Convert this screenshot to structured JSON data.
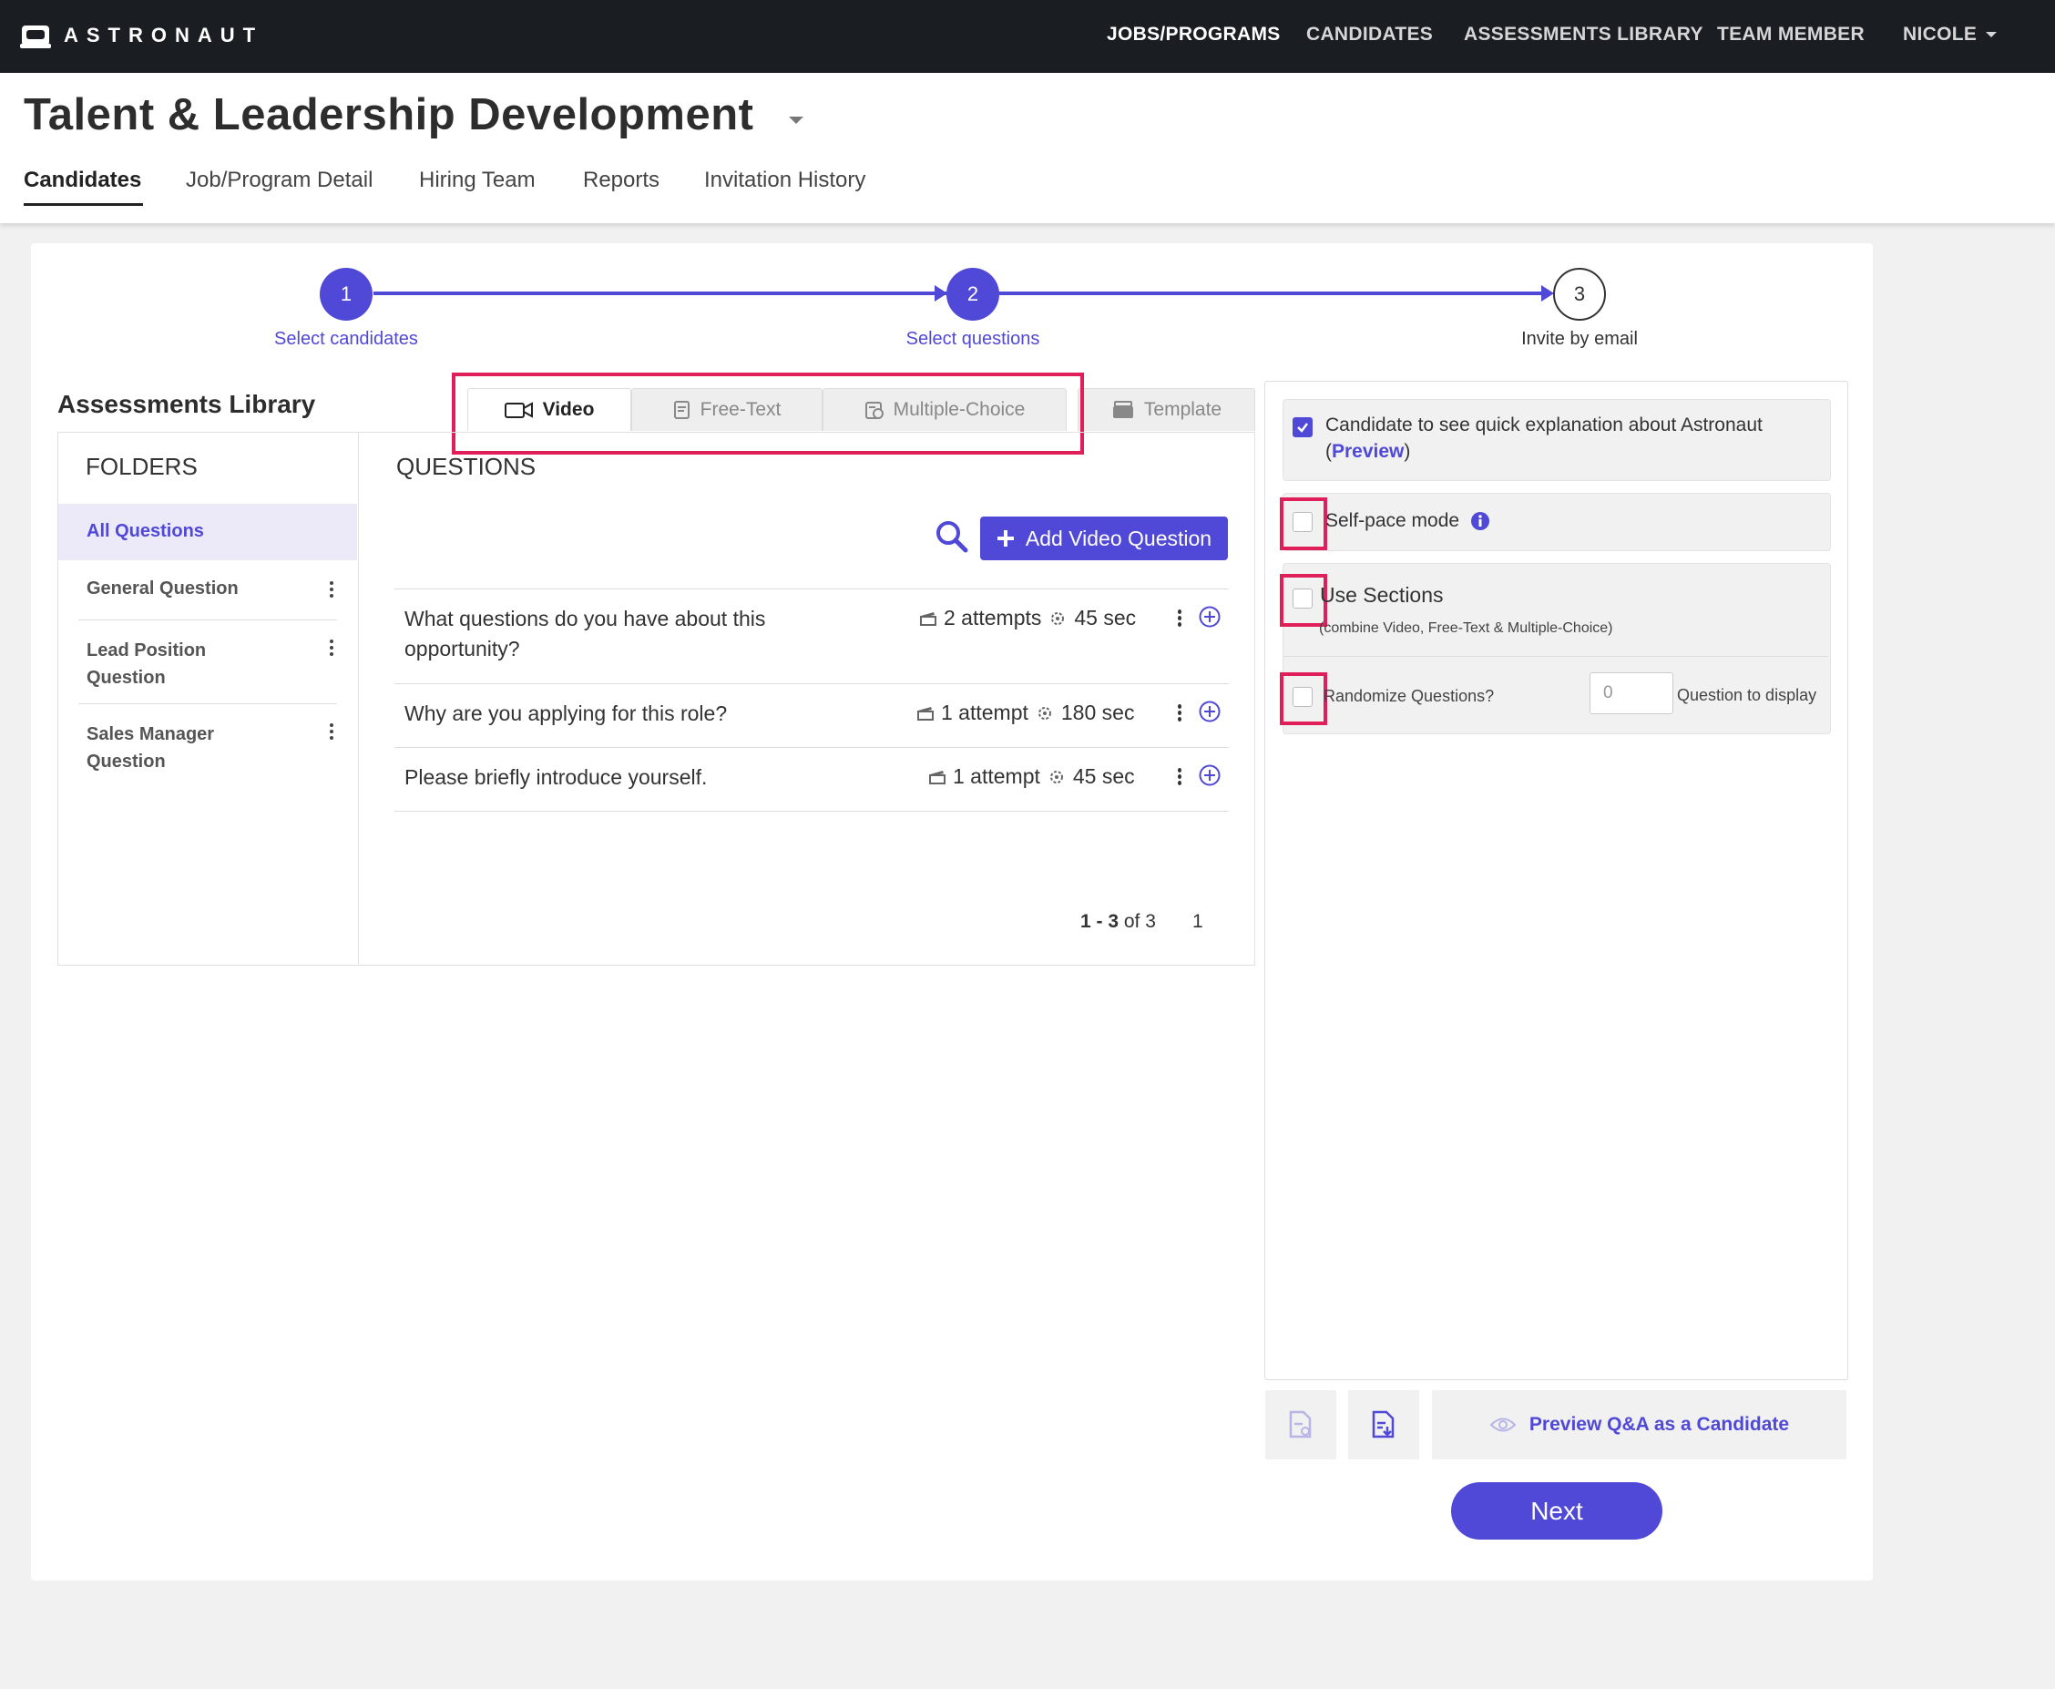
{
  "nav": {
    "logo": "ASTRONAUT",
    "links": [
      "JOBS/PROGRAMS",
      "CANDIDATES",
      "ASSESSMENTS LIBRARY",
      "TEAM MEMBER"
    ],
    "user": "NICOLE"
  },
  "header": {
    "title": "Talent & Leadership Development",
    "tabs": [
      "Candidates",
      "Job/Program Detail",
      "Hiring Team",
      "Reports",
      "Invitation History"
    ]
  },
  "stepper": {
    "steps": [
      {
        "number": "1",
        "label": "Select candidates"
      },
      {
        "number": "2",
        "label": "Select questions"
      },
      {
        "number": "3",
        "label": "Invite by email"
      }
    ]
  },
  "library": {
    "title": "Assessments Library",
    "tabs": [
      "Video",
      "Free-Text",
      "Multiple-Choice",
      "Template"
    ],
    "folders_heading": "FOLDERS",
    "folders": [
      "All Questions",
      "General Question",
      "Lead Position Question",
      "Sales Manager Question"
    ],
    "questions_heading": "QUESTIONS",
    "add_button": "Add Video Question",
    "questions": [
      {
        "text": "What questions do you have about this opportunity?",
        "attempts": "2 attempts",
        "time": "45 sec"
      },
      {
        "text": "Why are you applying for this role?",
        "attempts": "1 attempt",
        "time": "180 sec"
      },
      {
        "text": "Please briefly introduce yourself.",
        "attempts": "1 attempt",
        "time": "45 sec"
      }
    ],
    "pager": {
      "range": "1 - 3",
      "of": "of 3",
      "page": "1"
    }
  },
  "options": {
    "explanation": "Candidate to see quick explanation about Astronaut",
    "explanation_paren_open": "(",
    "preview_link": "Preview",
    "explanation_paren_close": ")",
    "self_pace": "Self-pace mode",
    "use_sections": "Use Sections",
    "use_sections_note": "(combine Video, Free-Text & Multiple-Choice)",
    "randomize": "Randomize Questions?",
    "randomize_value": "0",
    "question_to_display": "Question to display",
    "preview_candidate": "Preview Q&A as a Candidate",
    "next": "Next"
  },
  "colors": {
    "accent": "#5048d6",
    "highlight": "#e01e5a",
    "nav_bg": "#1a1d22"
  }
}
